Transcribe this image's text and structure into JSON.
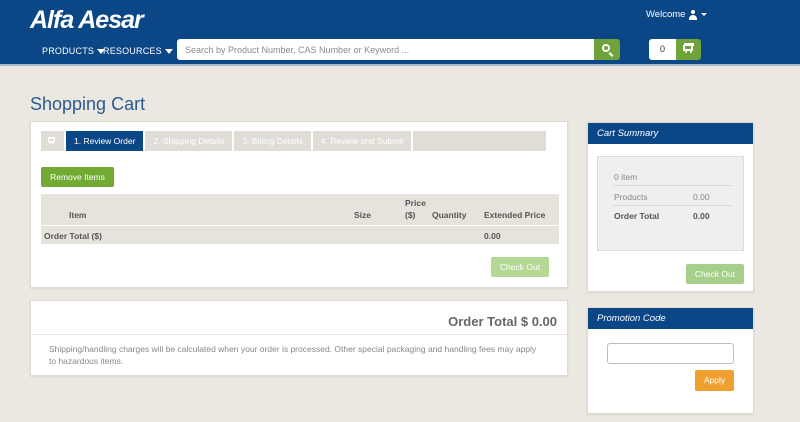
{
  "header": {
    "logo_text": "Alfa Aesar",
    "welcome_label": "Welcome",
    "nav": {
      "products": "PRODUCTS",
      "resources": "RESOURCES"
    },
    "search_placeholder": "Search by Product Number, CAS Number or Keyword ...",
    "cart_count": "0"
  },
  "page_title": "Shopping Cart",
  "steps": [
    "1. Review Order",
    "2. Shipping Details",
    "3. Billing Details",
    "4. Review and Submit"
  ],
  "cart": {
    "remove_label": "Remove Items",
    "columns": {
      "item": "Item",
      "size": "Size",
      "price_line1": "Price",
      "price_line2": "($)",
      "quantity": "Quantity",
      "extended_price": "Extended Price"
    },
    "order_total_label": "Order Total ($)",
    "order_total_value": "0.00",
    "checkout_label": "Check Out"
  },
  "total_panel": {
    "order_total_text": "Order Total $ 0.00",
    "shipping_note": "Shipping/handling charges will be calculated when your order is processed. Other special packaging and handling fees may apply to hazardous items."
  },
  "cart_summary": {
    "title": "Cart Summary",
    "item_count": "0 item",
    "products_label": "Products",
    "products_value": "0.00",
    "order_total_label": "Order Total",
    "order_total_value": "0.00",
    "checkout_label": "Check Out"
  },
  "promotion": {
    "title": "Promotion Code",
    "input_value": "",
    "apply_label": "Apply"
  },
  "colors": {
    "header_blue": "#0b4687",
    "accent_green": "#7cb342",
    "apply_orange": "#f0a02f",
    "page_background": "#ebe8e2"
  }
}
